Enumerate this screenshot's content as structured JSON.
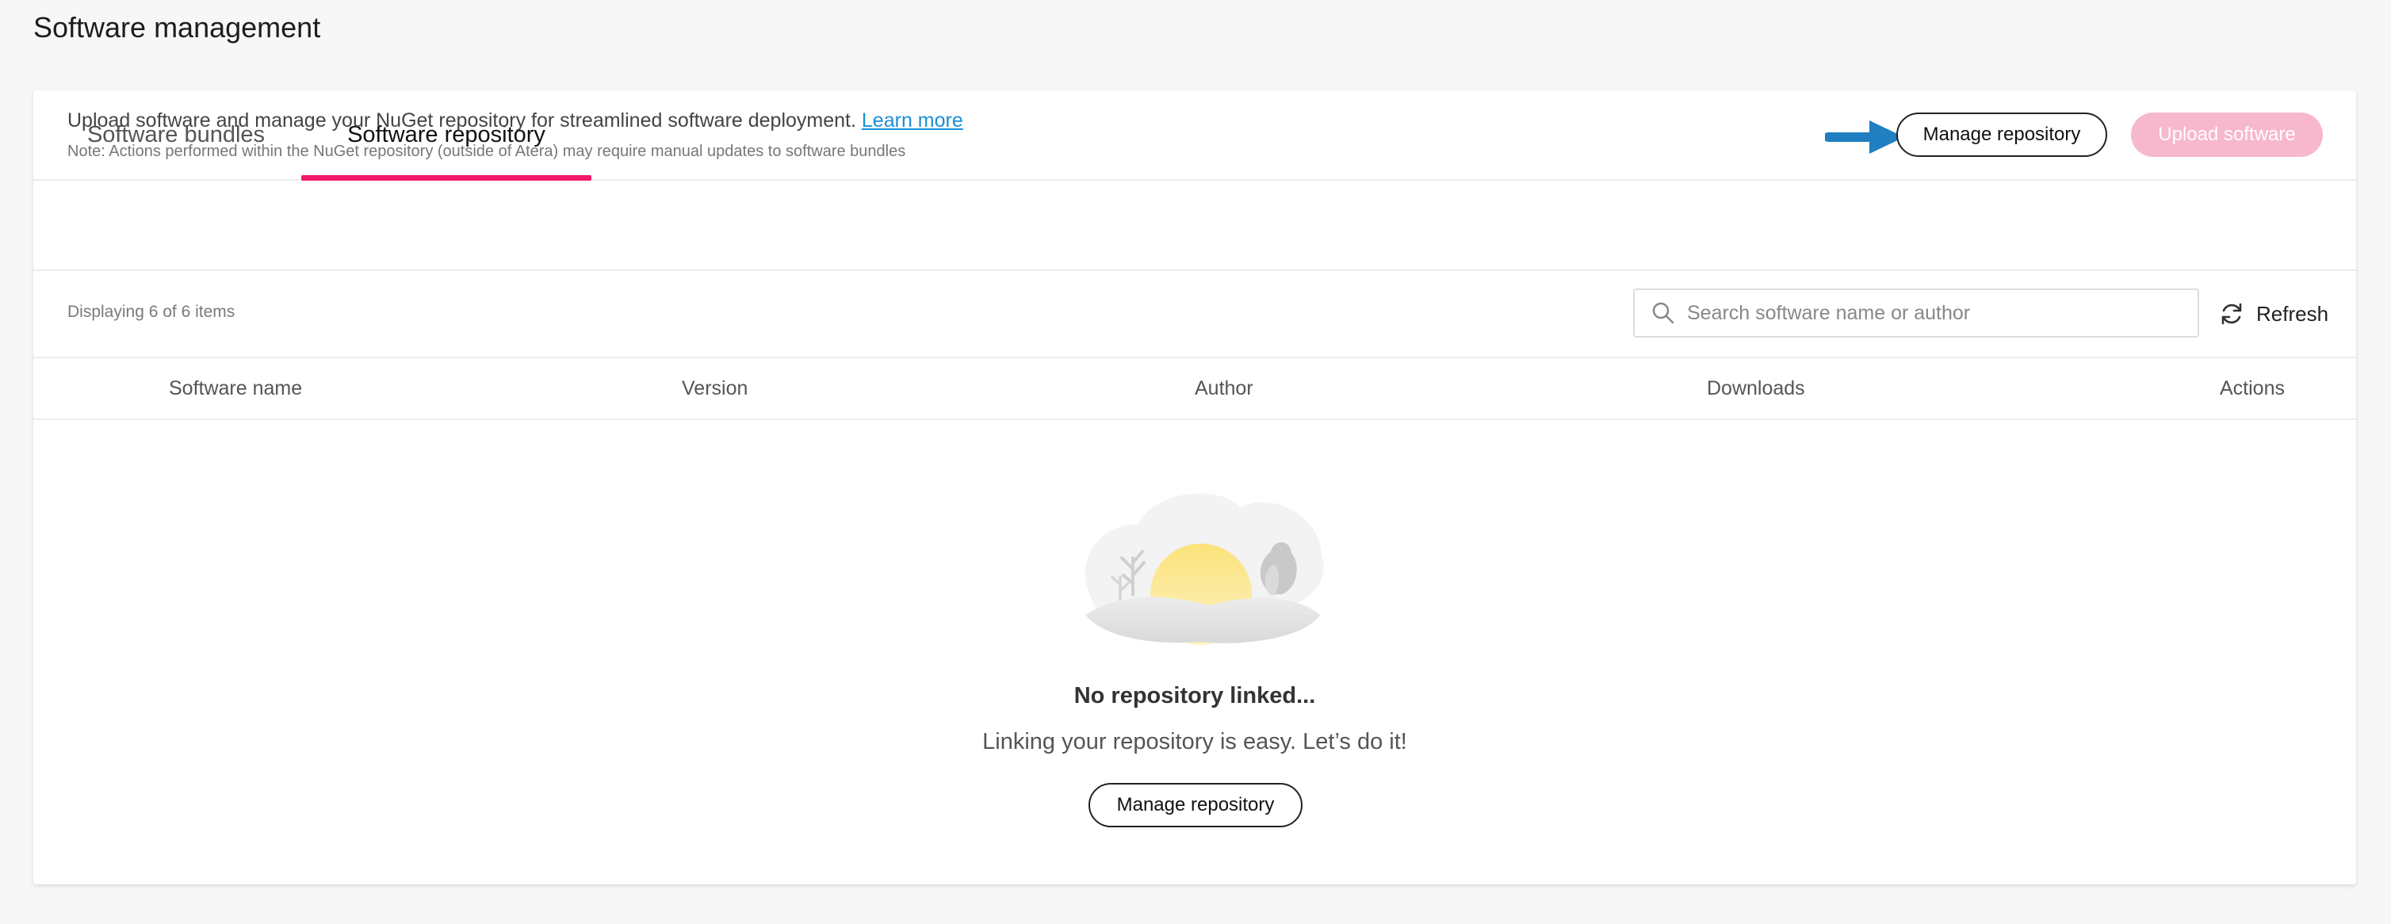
{
  "page": {
    "title": "Software management"
  },
  "tabs": [
    {
      "label": "Software bundles",
      "active": false
    },
    {
      "label": "Software repository",
      "active": true
    }
  ],
  "info": {
    "description": "Upload software and manage your NuGet repository for streamlined software deployment.",
    "learn_more": "Learn more",
    "note": "Note: Actions performed within the NuGet repository (outside of Atera) may require manual updates to software bundles"
  },
  "actions": {
    "manage_repository": "Manage repository",
    "upload_software": "Upload software"
  },
  "list": {
    "displaying": "Displaying 6 of 6 items",
    "search_placeholder": "Search software name or author",
    "refresh": "Refresh"
  },
  "table": {
    "columns": [
      "Software name",
      "Version",
      "Author",
      "Downloads",
      "Actions"
    ]
  },
  "empty_state": {
    "title": "No repository linked...",
    "subtitle": "Linking your repository is easy. Let’s do it!",
    "button": "Manage repository"
  },
  "colors": {
    "accent": "#f0196b",
    "upload_disabled": "#f7b8cd",
    "link": "#1a8fd8",
    "arrow": "#1f7fc0"
  },
  "icons": [
    "search-icon",
    "refresh-icon",
    "pointer-arrow-icon",
    "empty-state-illustration"
  ]
}
